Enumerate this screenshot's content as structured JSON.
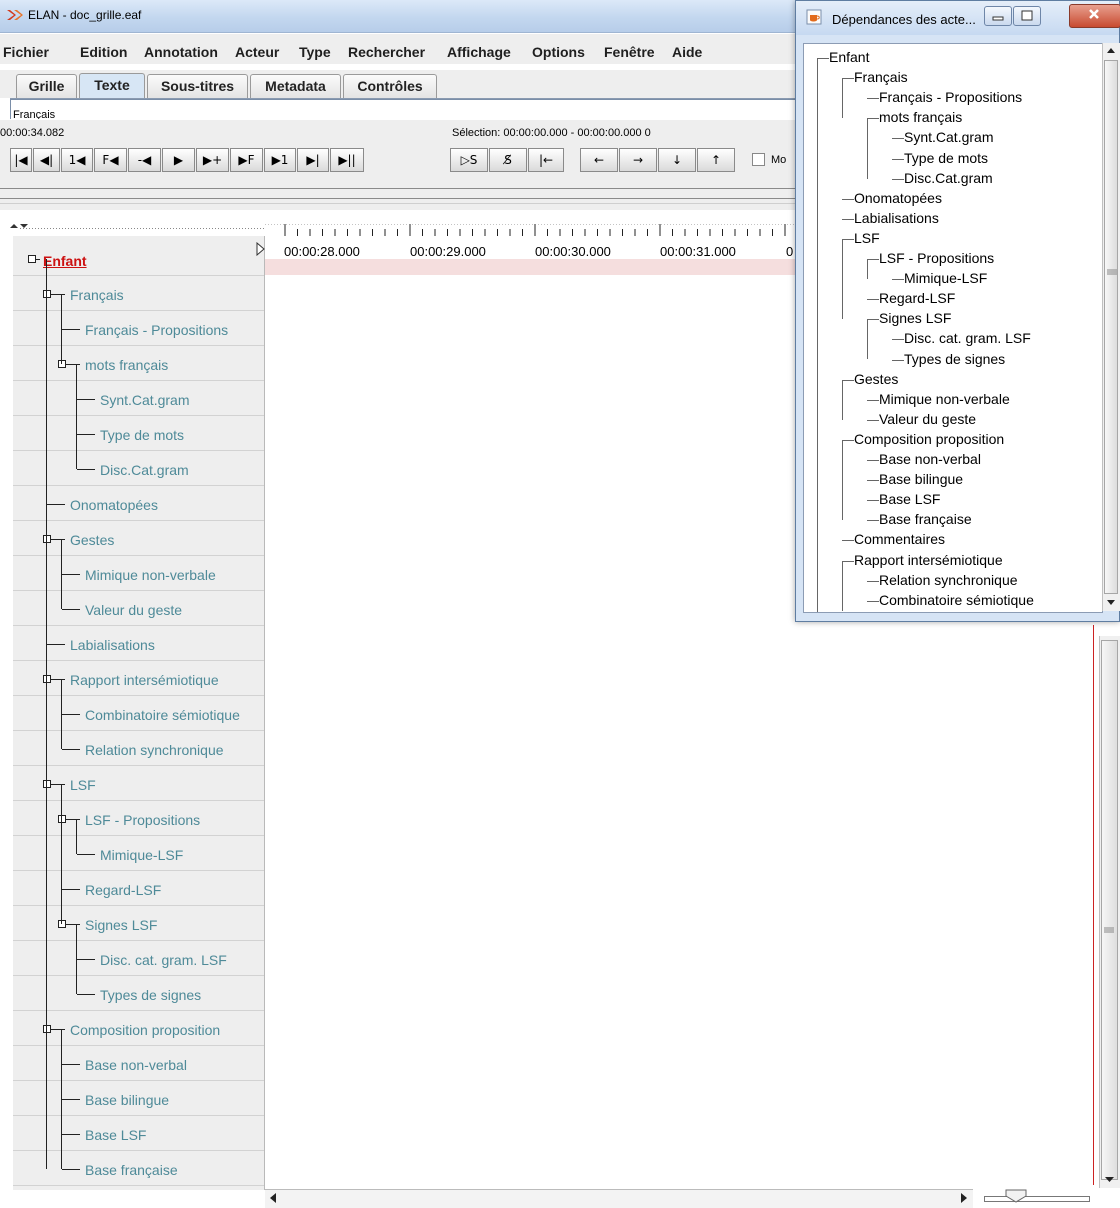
{
  "window": {
    "title": "ELAN - doc_grille.eaf"
  },
  "menu": [
    "Fichier",
    "Edition",
    "Annotation",
    "Acteur",
    "Type",
    "Rechercher",
    "Affichage",
    "Options",
    "Fenêtre",
    "Aide"
  ],
  "tabs": [
    "Grille",
    "Texte",
    "Sous-titres",
    "Metadata",
    "Contrôles"
  ],
  "active_tab": "Texte",
  "text_field": {
    "value": "Français"
  },
  "media": {
    "current_time": "00:00:34.082",
    "selection": "Sélection: 00:00:00.000 - 00:00:00.000  0",
    "mode_label": "Mo"
  },
  "transport_buttons": [
    "|◀",
    "◀|",
    "1◀",
    "F◀",
    "-◀",
    "▶",
    "▶+",
    "▶F",
    "▶1",
    "▶|",
    "▶||"
  ],
  "selection_buttons": [
    "▷S",
    "S̸",
    "|←"
  ],
  "nav_buttons": [
    "←",
    "→",
    "↓",
    "↑"
  ],
  "timeline_ticks": [
    "00:00:28.000",
    "00:00:29.000",
    "00:00:30.000",
    "00:00:31.000",
    "0"
  ],
  "tiers": [
    {
      "label": "Enfant",
      "depth": 0,
      "root": true
    },
    {
      "label": "Français",
      "depth": 1,
      "expand": true
    },
    {
      "label": "Français - Propositions",
      "depth": 2
    },
    {
      "label": "mots français",
      "depth": 2,
      "expand": true
    },
    {
      "label": "Synt.Cat.gram",
      "depth": 3
    },
    {
      "label": "Type de mots",
      "depth": 3
    },
    {
      "label": "Disc.Cat.gram",
      "depth": 3
    },
    {
      "label": "Onomatopées",
      "depth": 1
    },
    {
      "label": "Gestes",
      "depth": 1,
      "expand": true
    },
    {
      "label": "Mimique non-verbale",
      "depth": 2
    },
    {
      "label": "Valeur du geste",
      "depth": 2
    },
    {
      "label": "Labialisations",
      "depth": 1
    },
    {
      "label": "Rapport intersémiotique",
      "depth": 1,
      "expand": true
    },
    {
      "label": "Combinatoire sémiotique",
      "depth": 2
    },
    {
      "label": "Relation synchronique",
      "depth": 2
    },
    {
      "label": "LSF",
      "depth": 1,
      "expand": true
    },
    {
      "label": "LSF - Propositions",
      "depth": 2,
      "expand": true
    },
    {
      "label": "Mimique-LSF",
      "depth": 3
    },
    {
      "label": "Regard-LSF",
      "depth": 2
    },
    {
      "label": "Signes LSF",
      "depth": 2,
      "expand": true
    },
    {
      "label": "Disc. cat. gram. LSF",
      "depth": 3
    },
    {
      "label": "Types de signes",
      "depth": 3
    },
    {
      "label": "Composition proposition",
      "depth": 1,
      "expand": true
    },
    {
      "label": "Base non-verbal",
      "depth": 2
    },
    {
      "label": "Base bilingue",
      "depth": 2
    },
    {
      "label": "Base LSF",
      "depth": 2
    },
    {
      "label": "Base française",
      "depth": 2
    }
  ],
  "dependencies_window": {
    "title": "Dépendances des acte...",
    "items": [
      {
        "label": "Enfant",
        "depth": 0
      },
      {
        "label": "Français",
        "depth": 1
      },
      {
        "label": "Français - Propositions",
        "depth": 2
      },
      {
        "label": "mots français",
        "depth": 2
      },
      {
        "label": "Synt.Cat.gram",
        "depth": 3
      },
      {
        "label": "Type de mots",
        "depth": 3
      },
      {
        "label": "Disc.Cat.gram",
        "depth": 3
      },
      {
        "label": "Onomatopées",
        "depth": 1
      },
      {
        "label": "Labialisations",
        "depth": 1
      },
      {
        "label": "LSF",
        "depth": 1
      },
      {
        "label": "LSF - Propositions",
        "depth": 2
      },
      {
        "label": "Mimique-LSF",
        "depth": 3
      },
      {
        "label": "Regard-LSF",
        "depth": 2
      },
      {
        "label": "Signes LSF",
        "depth": 2
      },
      {
        "label": "Disc. cat. gram. LSF",
        "depth": 3
      },
      {
        "label": "Types de signes",
        "depth": 3
      },
      {
        "label": "Gestes",
        "depth": 1
      },
      {
        "label": "Mimique non-verbale",
        "depth": 2
      },
      {
        "label": "Valeur du geste",
        "depth": 2
      },
      {
        "label": "Composition proposition",
        "depth": 1
      },
      {
        "label": "Base non-verbal",
        "depth": 2
      },
      {
        "label": "Base bilingue",
        "depth": 2
      },
      {
        "label": "Base LSF",
        "depth": 2
      },
      {
        "label": "Base française",
        "depth": 2
      },
      {
        "label": "Commentaires",
        "depth": 1
      },
      {
        "label": "Rapport intersémiotique",
        "depth": 1
      },
      {
        "label": "Relation synchronique",
        "depth": 2
      },
      {
        "label": "Combinatoire sémiotique",
        "depth": 2
      }
    ]
  },
  "colors": {
    "tier_label": "#4e8a98",
    "root_tier": "#cc1111",
    "crosshair": "#cc2222"
  },
  "icons": {
    "app": "elan-logo-icon",
    "java": "java-cup-icon",
    "minimize": "minimize-icon",
    "maximize": "maximize-icon",
    "close": "close-icon"
  }
}
